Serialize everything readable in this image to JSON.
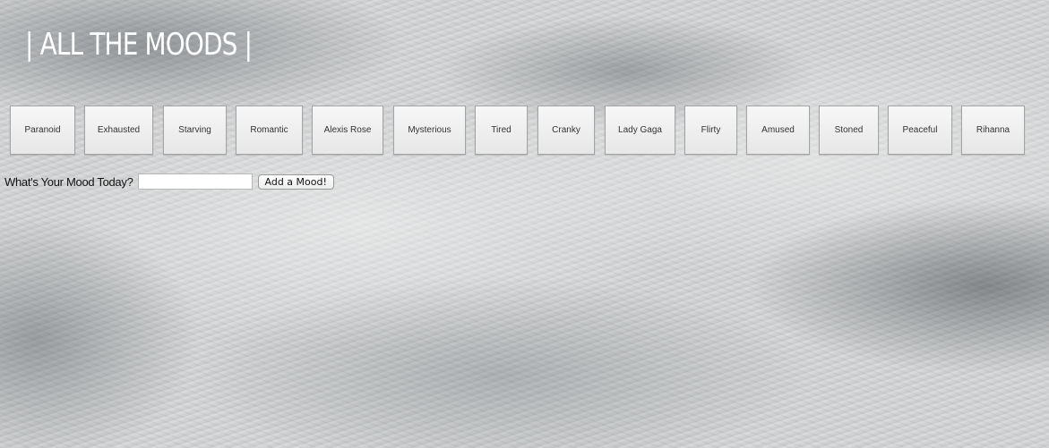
{
  "header": {
    "title": "| ALL THE MOODS |"
  },
  "moods": [
    "Paranoid",
    "Exhausted",
    "Starving",
    "Romantic",
    "Alexis Rose",
    "Mysterious",
    "Tired",
    "Cranky",
    "Lady Gaga",
    "Flirty",
    "Amused",
    "Stoned",
    "Peaceful",
    "Rihanna"
  ],
  "form": {
    "label": "What's Your Mood Today?",
    "input_value": "",
    "button_label": "Add a Mood!"
  }
}
